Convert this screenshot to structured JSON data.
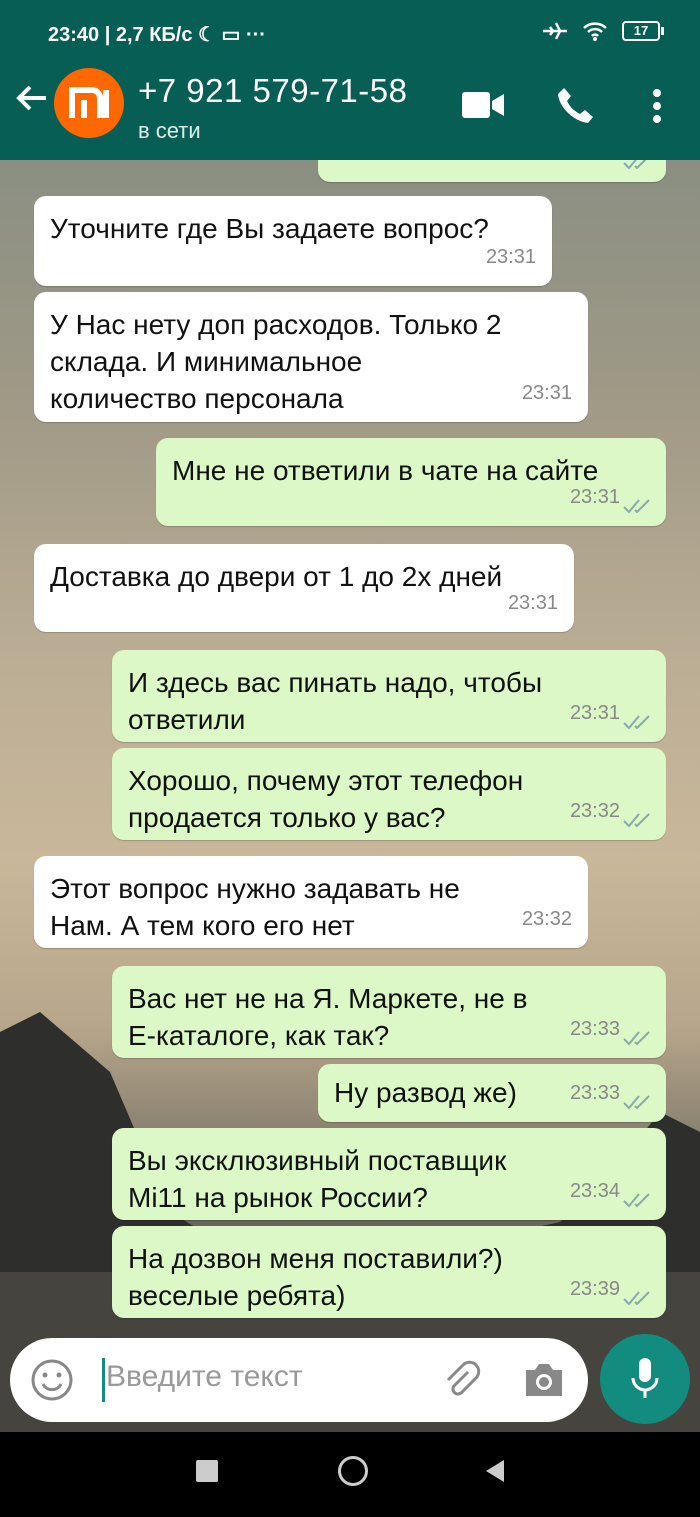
{
  "status_bar": {
    "left_text": "23:40 | 2,7 КБ/с ☾ ▭ ···",
    "battery": "17"
  },
  "header": {
    "contact_name": "+7 921 579-71-58",
    "contact_status": "в сети"
  },
  "messages": [
    {
      "dir": "in",
      "text": "Уточните где Вы задаете вопрос?",
      "time": "23:31"
    },
    {
      "dir": "in",
      "text": "У Нас нету доп расходов. Только 2\nсклада. И минимальное\nколичество персонала",
      "time": "23:31"
    },
    {
      "dir": "out",
      "text": "Мне не ответили в чате на сайте",
      "time": "23:31"
    },
    {
      "dir": "in",
      "text": "Доставка до двери от 1 до 2х дней",
      "time": "23:31"
    },
    {
      "dir": "out",
      "text": "И здесь вас пинать надо, чтобы\nответили",
      "time": "23:31"
    },
    {
      "dir": "out",
      "text": "Хорошо, почему этот телефон\nпродается только у вас?",
      "time": "23:32"
    },
    {
      "dir": "in",
      "text": "Этот вопрос нужно задавать не\nНам. А тем кого его нет",
      "time": "23:32"
    },
    {
      "dir": "out",
      "text": "Вас нет не на Я. Маркете, не в\nЕ-каталоге, как так?",
      "time": "23:33"
    },
    {
      "dir": "out",
      "text": "Ну развод же)",
      "time": "23:33"
    },
    {
      "dir": "out",
      "text": "Вы эксклюзивный поставщик\nMi11 на рынок России?",
      "time": "23:34"
    },
    {
      "dir": "out",
      "text": "На дозвон меня поставили?)\nвеселые ребята)",
      "time": "23:39"
    }
  ],
  "input": {
    "placeholder": "Введите текст"
  },
  "colors": {
    "header": "#075e54",
    "outgoing": "#dcf8c6",
    "incoming": "#ffffff",
    "accent": "#128c7e"
  }
}
